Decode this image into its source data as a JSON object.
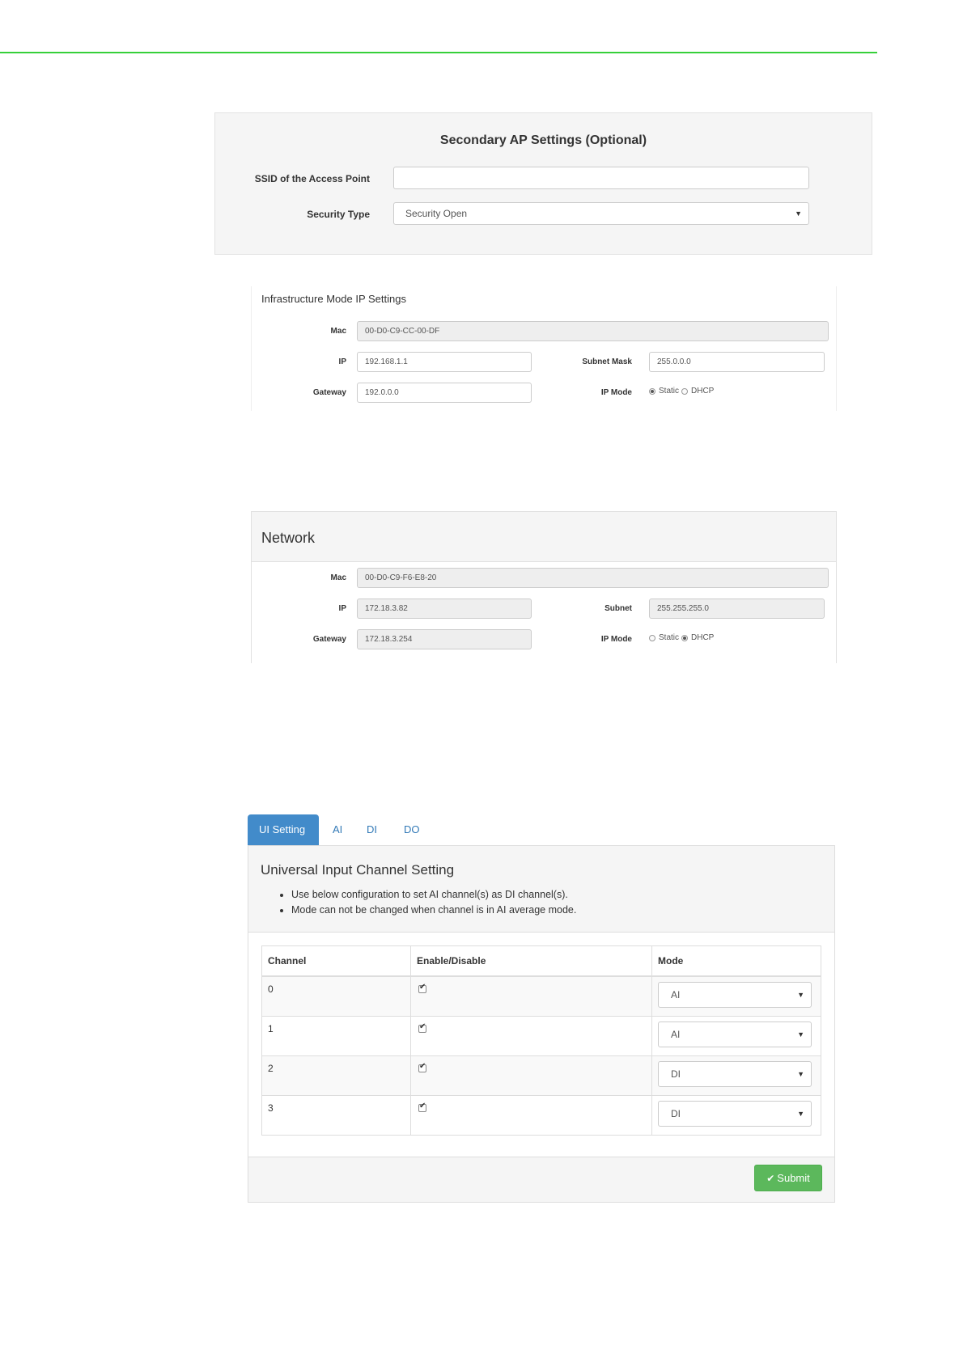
{
  "secondary_ap": {
    "title": "Secondary AP Settings (Optional)",
    "ssid_label": "SSID of the Access Point",
    "ssid_value": "",
    "security_label": "Security Type",
    "security_value": "Security Open"
  },
  "infrastructure": {
    "title": "Infrastructure Mode IP Settings",
    "mac_label": "Mac",
    "mac_value": "00-D0-C9-CC-00-DF",
    "ip_label": "IP",
    "ip_value": "192.168.1.1",
    "subnet_label": "Subnet Mask",
    "subnet_value": "255.0.0.0",
    "gateway_label": "Gateway",
    "gateway_value": "192.0.0.0",
    "ipmode_label": "IP Mode",
    "static_label": "Static",
    "dhcp_label": "DHCP",
    "selected_mode": "Static"
  },
  "network": {
    "title": "Network",
    "mac_label": "Mac",
    "mac_value": "00-D0-C9-F6-E8-20",
    "ip_label": "IP",
    "ip_value": "172.18.3.82",
    "subnet_label": "Subnet",
    "subnet_value": "255.255.255.0",
    "gateway_label": "Gateway",
    "gateway_value": "172.18.3.254",
    "ipmode_label": "IP Mode",
    "static_label": "Static",
    "dhcp_label": "DHCP",
    "selected_mode": "DHCP"
  },
  "tabs": [
    {
      "label": "UI Setting",
      "active": true
    },
    {
      "label": "AI",
      "active": false
    },
    {
      "label": "DI",
      "active": false
    },
    {
      "label": "DO",
      "active": false
    }
  ],
  "ui_setting": {
    "title": "Universal Input Channel Setting",
    "bullets": [
      "Use below configuration to set AI channel(s) as DI channel(s).",
      "Mode can not be changed when channel is in AI average mode."
    ],
    "columns": [
      "Channel",
      "Enable/Disable",
      "Mode"
    ],
    "rows": [
      {
        "channel": "0",
        "enabled": true,
        "mode": "AI"
      },
      {
        "channel": "1",
        "enabled": true,
        "mode": "AI"
      },
      {
        "channel": "2",
        "enabled": true,
        "mode": "DI"
      },
      {
        "channel": "3",
        "enabled": true,
        "mode": "DI"
      }
    ],
    "submit_label": "Submit",
    "submit_icon": "check-icon"
  },
  "colors": {
    "rule_green": "#36d03a",
    "tab_active": "#428bca",
    "submit_green": "#5cb85c"
  }
}
